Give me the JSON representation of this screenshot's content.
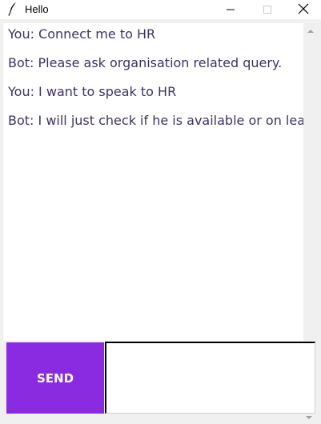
{
  "window": {
    "title": "Hello",
    "icon": "feather-icon",
    "controls": [
      "minimize-icon",
      "maximize-icon",
      "close-icon"
    ]
  },
  "chat": {
    "messages": [
      "You: Connect me to HR",
      "Bot: Please ask organisation related query.",
      "You: I want to speak to HR",
      "Bot: I will just check if he is available or on  leave"
    ],
    "text_color": "#3f3262"
  },
  "send_button": {
    "label": "SEND",
    "color": "#8a2be2"
  },
  "entry": {
    "value": ""
  }
}
